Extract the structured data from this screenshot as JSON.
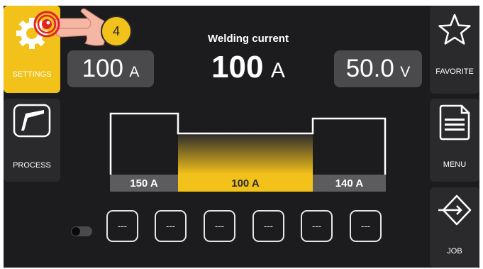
{
  "sidebar_left": {
    "settings_label": "SETTINGS",
    "process_label": "PROCESS"
  },
  "sidebar_right": {
    "favorite_label": "FAVORITE",
    "menu_label": "MENU",
    "job_label": "JOB"
  },
  "callout": {
    "number": "4"
  },
  "main": {
    "title": "Welding current",
    "current_value": "100",
    "current_unit": "A",
    "left_value": "100",
    "left_unit": "A",
    "right_value": "50.0",
    "right_unit": "V"
  },
  "profile": {
    "segments": [
      {
        "label": "150 A"
      },
      {
        "label": "100 A"
      },
      {
        "label": "140 A"
      }
    ]
  },
  "memory_slots": [
    "---",
    "---",
    "---",
    "---",
    "---",
    "---"
  ],
  "colors": {
    "accent": "#f3c21a",
    "screen_bg": "#1c1c1e",
    "panel_bg": "#2a2a2c",
    "value_box": "#4a4a4c",
    "touch_red": "#e32028"
  },
  "icons": {
    "settings": "gear-icon",
    "process": "welding-torch-icon",
    "favorite": "star-icon",
    "menu": "document-menu-icon",
    "job": "job-arrow-icon",
    "touch": "tap-finger-icon"
  }
}
